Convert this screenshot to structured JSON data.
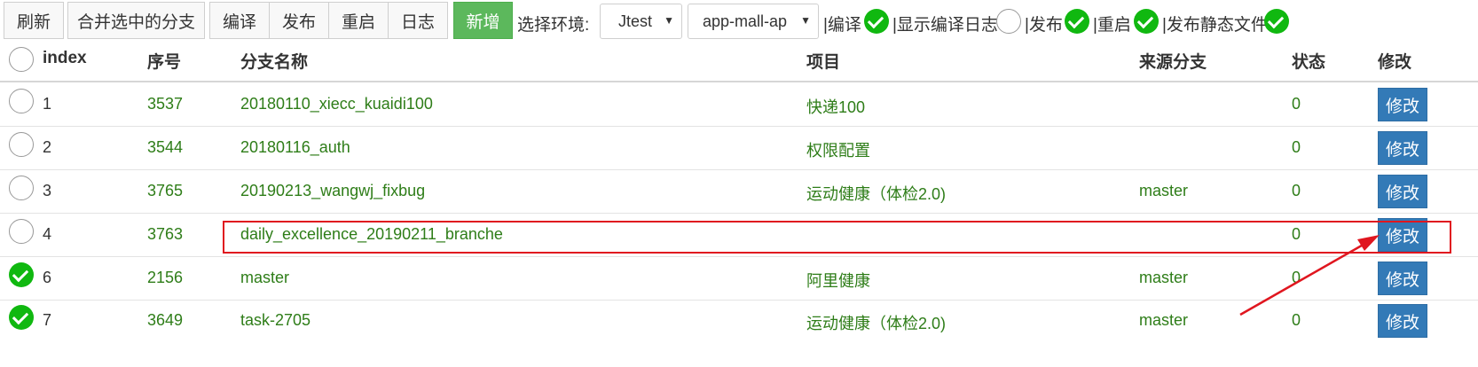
{
  "toolbar": {
    "refresh": "刷新",
    "merge": "合并选中的分支",
    "compile": "编译",
    "publish": "发布",
    "restart": "重启",
    "log": "日志",
    "add": "新增",
    "env_label": "选择环境:",
    "env_value": "Jtest",
    "app_value": "app-mall-ap",
    "opt_compile": "|编译",
    "opt_show_log": "|显示编译日志",
    "opt_publish": "|发布",
    "opt_restart": "|重启",
    "opt_static": "|发布静态文件",
    "opt_compile_checked": true,
    "opt_show_log_checked": false,
    "opt_publish_checked": true,
    "opt_restart_checked": true,
    "opt_static_checked": true
  },
  "table": {
    "headers": {
      "index": "index",
      "seq": "序号",
      "branch": "分支名称",
      "project": "项目",
      "source": "来源分支",
      "status": "状态",
      "edit": "修改"
    },
    "rows": [
      {
        "index": "1",
        "seq": "3537",
        "branch": "20180110_xiecc_kuaidi100",
        "project": "快递100",
        "source": "",
        "status": "0",
        "edit": "修改",
        "checked": false
      },
      {
        "index": "2",
        "seq": "3544",
        "branch": "20180116_auth",
        "project": "权限配置",
        "source": "",
        "status": "0",
        "edit": "修改",
        "checked": false
      },
      {
        "index": "3",
        "seq": "3765",
        "branch": "20190213_wangwj_fixbug",
        "project": "运动健康（体检2.0)",
        "source": "master",
        "status": "0",
        "edit": "修改",
        "checked": false
      },
      {
        "index": "4",
        "seq": "3763",
        "branch": "daily_excellence_20190211_branche",
        "project": "",
        "source": "",
        "status": "0",
        "edit": "修改",
        "checked": false
      },
      {
        "index": "6",
        "seq": "2156",
        "branch": "master",
        "project": "阿里健康",
        "source": "master",
        "status": "0",
        "edit": "修改",
        "checked": true
      },
      {
        "index": "7",
        "seq": "3649",
        "branch": "task-2705",
        "project": "运动健康（体检2.0)",
        "source": "master",
        "status": "0",
        "edit": "修改",
        "checked": true
      }
    ]
  },
  "colors": {
    "text_green": "#2e7d18",
    "check_green": "#10b810",
    "edit_blue": "#337ab7",
    "add_green": "#5cb85c",
    "annotation_red": "#e0161f"
  }
}
